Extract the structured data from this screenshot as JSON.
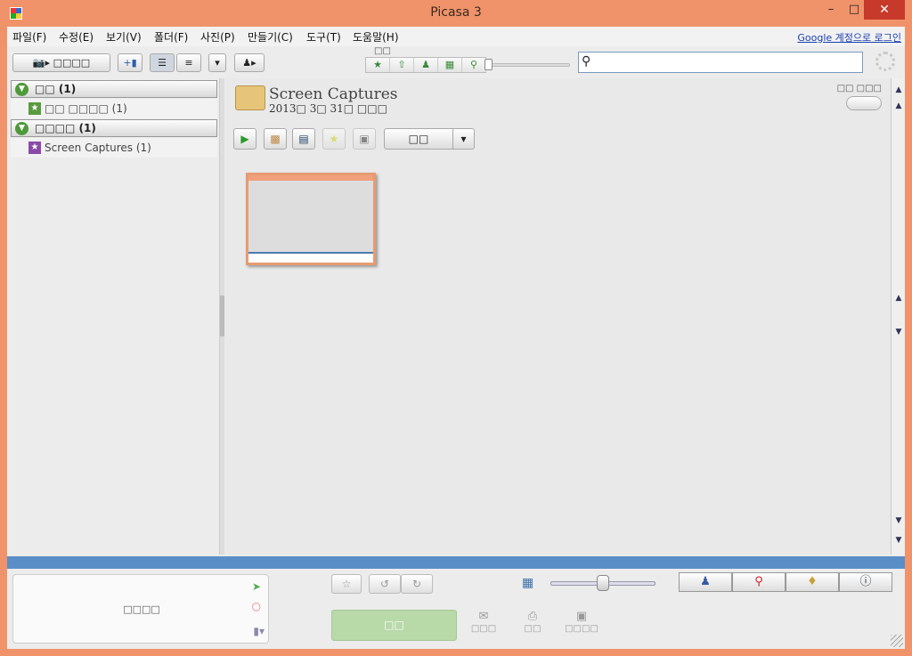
{
  "window": {
    "title": "Picasa 3",
    "min_icon": "minimize-icon",
    "max_icon": "maximize-icon",
    "close_icon": "close-icon"
  },
  "menu": {
    "items": [
      "파일(F)",
      "수정(E)",
      "보기(V)",
      "폴더(F)",
      "사진(P)",
      "만들기(C)",
      "도구(T)",
      "도움말(H)"
    ],
    "login": "Google 계정으로 로그인"
  },
  "toolbar": {
    "import_label": "□□□□",
    "filter_label": "□□",
    "search_placeholder": ""
  },
  "left": {
    "section1": {
      "label": "□□ (1)"
    },
    "section1_item": {
      "label": "□□ □□□□ (1)"
    },
    "section2": {
      "label": "□□□□ (1)"
    },
    "section2_item": {
      "label": "Screen Captures (1)"
    }
  },
  "main": {
    "folder_title": "Screen Captures",
    "folder_date": "2013□ 3□ 31□ □□□",
    "topright": "□□ □□□",
    "dropdown_label": "□□"
  },
  "bottom": {
    "tray_label": "□□□□",
    "upload_label": "□□",
    "email_label": "□□□",
    "print_label": "□□",
    "export_label": "□□□□"
  },
  "colors": {
    "frame": "#f0936a",
    "status": "#5a8ec6",
    "upload": "#b8d9a8"
  }
}
